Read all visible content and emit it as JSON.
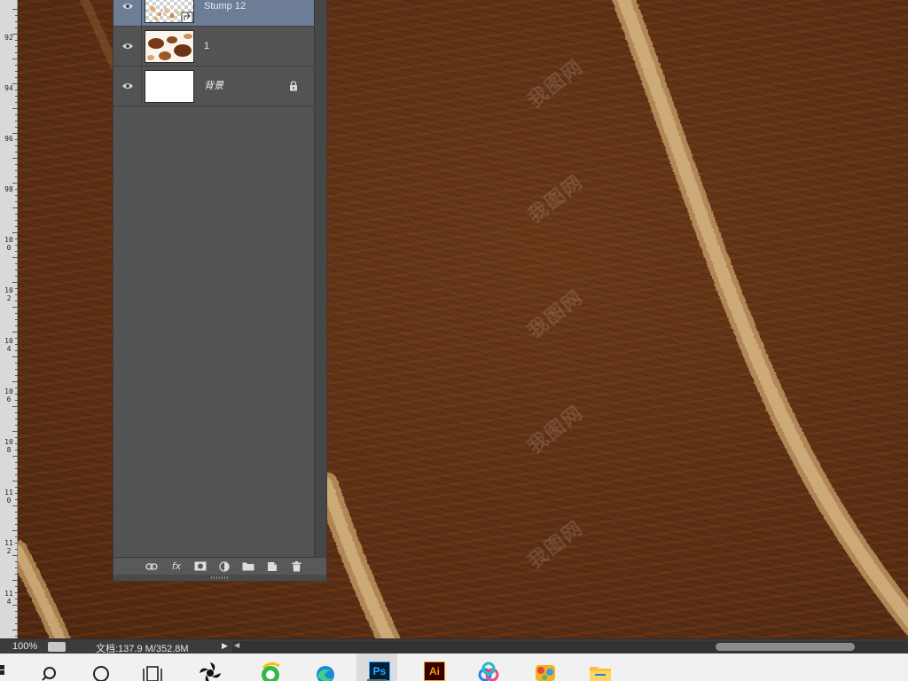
{
  "layers_panel": {
    "layers": [
      {
        "name": "Stump 12",
        "visible": true,
        "selected": true,
        "thumbnail": "checker-with-sawdust",
        "smart_object": true
      },
      {
        "name": "1",
        "visible": true,
        "selected": false,
        "thumbnail": "brown-spots"
      },
      {
        "name": "背景",
        "visible": true,
        "selected": false,
        "thumbnail": "white",
        "locked": true
      }
    ],
    "footer_icons": [
      "link-layers-icon",
      "fx-icon",
      "layer-mask-icon",
      "adjustment-layer-icon",
      "group-folder-icon",
      "new-layer-icon",
      "trash-icon"
    ],
    "fx_label": "fx"
  },
  "ruler": {
    "labels": [
      "92",
      "94",
      "96",
      "98",
      "100",
      "102",
      "104",
      "106",
      "108",
      "110",
      "112",
      "114"
    ]
  },
  "status": {
    "zoom": "100%",
    "doc_info": "文档:137.9 M/352.8M",
    "arrow": "▶"
  },
  "taskbar": {
    "items": [
      "start-icon",
      "search-icon",
      "cortana-icon",
      "task-view-icon",
      "fan-app-icon",
      "browser-360-icon",
      "edge-icon",
      "photoshop-icon",
      "illustrator-icon",
      "baidu-netdisk-icon",
      "colorful-app-icon",
      "file-explorer-icon"
    ],
    "ps_label": "Ps",
    "ai_label": "Ai",
    "active": "photoshop-icon"
  },
  "colors": {
    "wood": "#5f3317",
    "ring": "#c9a572",
    "panel": "#535353",
    "selected_layer": "#6d7d96",
    "taskbar": "#f1f1f1"
  },
  "watermark": {
    "text": "我图网"
  }
}
